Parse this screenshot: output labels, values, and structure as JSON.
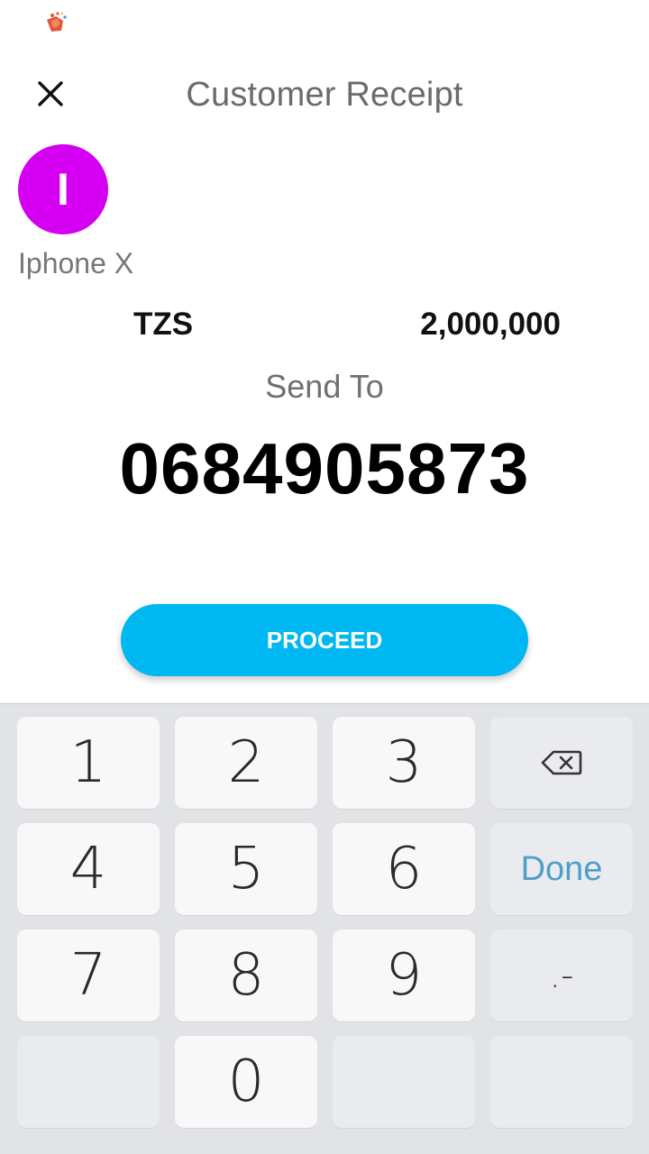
{
  "header": {
    "title": "Customer Receipt"
  },
  "customer": {
    "initial": "I",
    "name": "Iphone X",
    "avatar_color": "#d500f2"
  },
  "payment": {
    "currency": "TZS",
    "amount": "2,000,000"
  },
  "recipient": {
    "label": "Send To",
    "number": "0684905873"
  },
  "actions": {
    "proceed_label": "PROCEED",
    "accent_color": "#00b8f1"
  },
  "keypad": {
    "keys": [
      "1",
      "2",
      "3",
      "4",
      "5",
      "6",
      "7",
      "8",
      "9",
      "0"
    ],
    "done_label": "Done",
    "symbol_label": ".-",
    "backspace_icon": "backspace-icon"
  }
}
